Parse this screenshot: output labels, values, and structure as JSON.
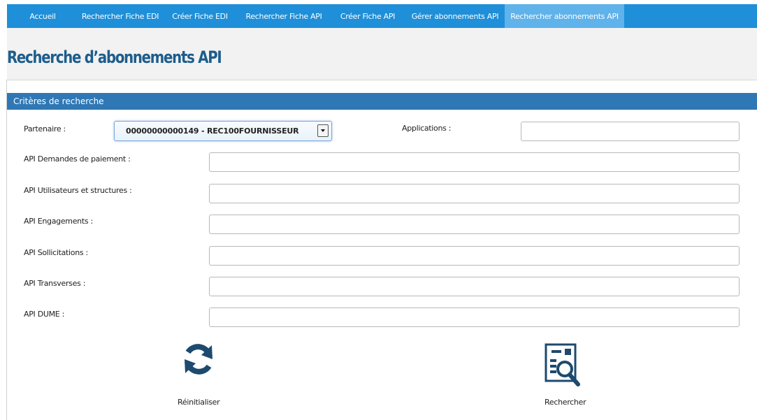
{
  "nav": {
    "items": [
      {
        "label": "Accueil"
      },
      {
        "label": "Rechercher Fiche EDI"
      },
      {
        "label": "Créer Fiche EDI"
      },
      {
        "label": "Rechercher Fiche API"
      },
      {
        "label": "Créer Fiche API"
      },
      {
        "label": "Gérer abonnements API"
      },
      {
        "label": "Rechercher abonnements API"
      }
    ],
    "active_index": 6
  },
  "page": {
    "title": "Recherche d’abonnements API"
  },
  "section": {
    "title": "Critères de recherche"
  },
  "form": {
    "partenaire_label": "Partenaire :",
    "partenaire_value": "00000000000149 - REC100FOURNISSEUR",
    "applications_label": "Applications :",
    "applications_value": "",
    "fields": [
      {
        "label": "API Demandes de paiement :",
        "value": ""
      },
      {
        "label": "API Utilisateurs et structures :",
        "value": ""
      },
      {
        "label": "API Engagements :",
        "value": ""
      },
      {
        "label": "API Sollicitations :",
        "value": ""
      },
      {
        "label": "API Transverses :",
        "value": ""
      },
      {
        "label": "API DUME :",
        "value": ""
      }
    ]
  },
  "actions": {
    "reset_label": "Réinitialiser",
    "search_label": "Rechercher"
  },
  "colors": {
    "nav_bg": "#1e8fd8",
    "nav_active": "#5fb2ea",
    "title": "#1d5d8c",
    "section_header": "#2f78b5",
    "icon": "#1d4a6e"
  },
  "icons": {
    "reset": "refresh-icon",
    "search": "document-search-icon"
  }
}
